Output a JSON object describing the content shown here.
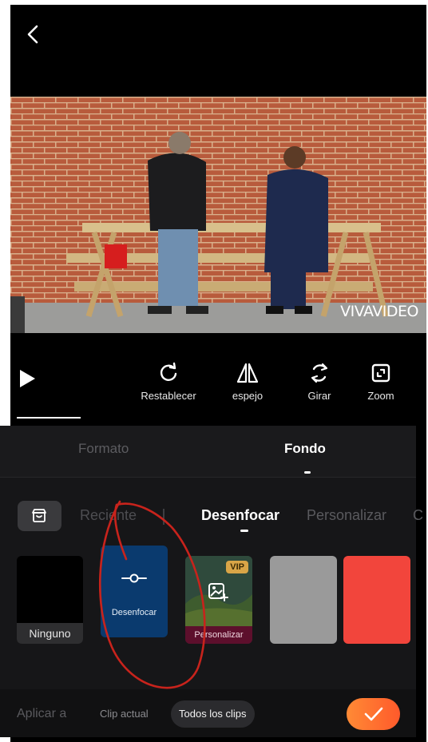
{
  "toolbar": {
    "tools": [
      {
        "label": "Restablecer",
        "icon": "reset-icon"
      },
      {
        "label": "espejo",
        "icon": "mirror-icon"
      },
      {
        "label": "Girar",
        "icon": "rotate-icon"
      },
      {
        "label": "Zoom",
        "icon": "zoom-icon"
      }
    ]
  },
  "video": {
    "watermark": "VIVAVIDEO"
  },
  "tabs": [
    {
      "label": "Formato"
    },
    {
      "label": "Fondo",
      "active": true
    }
  ],
  "subtabs": [
    {
      "label": "Reciente"
    },
    {
      "label": "Desenfocar",
      "active": true
    },
    {
      "label": "Personalizar"
    },
    {
      "label": "C"
    }
  ],
  "tiles": [
    {
      "label": "Ninguno",
      "color": "#000000"
    },
    {
      "label": "Desenfocar",
      "color": "#0a3a6e",
      "selected": true
    },
    {
      "label": "Personalizar",
      "badge": "VIP"
    },
    {
      "label": "",
      "color": "#9a9a9a"
    },
    {
      "label": "",
      "color": "#f2453c"
    }
  ],
  "bottom": {
    "apply_label": "Aplicar a",
    "chips": [
      {
        "label": "Clip actual"
      },
      {
        "label": "Todos los clips",
        "active": true
      }
    ]
  },
  "colors": {
    "accent": "#ff6a30",
    "background": "#161618",
    "annotation": "#c8231c"
  }
}
